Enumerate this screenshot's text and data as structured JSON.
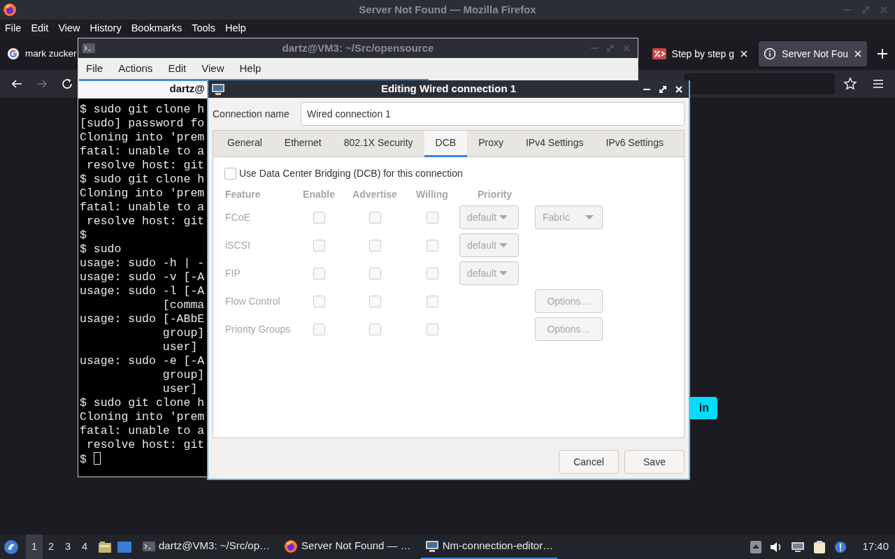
{
  "firefox": {
    "title": "Server Not Found — Mozilla Firefox",
    "menu": [
      "File",
      "Edit",
      "View",
      "History",
      "Bookmarks",
      "Tools",
      "Help"
    ],
    "tabs": [
      {
        "label": "mark zucker",
        "kind": "google",
        "selected": false
      },
      {
        "label": "Step by step g",
        "kind": "percent",
        "selected": false
      },
      {
        "label": "Server Not Fou",
        "kind": "info",
        "selected": true
      }
    ],
    "page_button": "in"
  },
  "terminal": {
    "title": "dartz@VM3: ~/Src/opensource",
    "menu": [
      "File",
      "Actions",
      "Edit",
      "View",
      "Help"
    ],
    "tab": "dartz@",
    "lines": [
      "$ sudo git clone h",
      "[sudo] password fo",
      "Cloning into 'prem",
      "fatal: unable to a",
      " resolve host: git",
      "$ sudo git clone h",
      "Cloning into 'prem",
      "fatal: unable to a",
      " resolve host: git",
      "$",
      "$ sudo",
      "usage: sudo -h | -",
      "usage: sudo -v [-A",
      "usage: sudo -l [-A",
      "            [comma",
      "usage: sudo [-ABbE",
      "            group]",
      "            user]",
      "usage: sudo -e [-A",
      "            group]",
      "            user]",
      "$ sudo git clone h",
      "Cloning into 'prem",
      "fatal: unable to a",
      " resolve host: git",
      "$ "
    ]
  },
  "dialog": {
    "title": "Editing Wired connection 1",
    "name_label": "Connection name",
    "name_value": "Wired connection 1",
    "tabs": [
      {
        "label": "General",
        "selected": false
      },
      {
        "label": "Ethernet",
        "selected": false
      },
      {
        "label": "802.1X Security",
        "selected": false
      },
      {
        "label": "DCB",
        "selected": true
      },
      {
        "label": "Proxy",
        "selected": false
      },
      {
        "label": "IPv4 Settings",
        "selected": false
      },
      {
        "label": "IPv6 Settings",
        "selected": false
      }
    ],
    "use_dcb": {
      "label": "Use Data Center Bridging (DCB) for this connection",
      "checked": false
    },
    "disabled": true,
    "columns": [
      "Feature",
      "Enable",
      "Advertise",
      "Willing",
      "Priority"
    ],
    "rows": [
      {
        "feature": "FCoE",
        "enable": false,
        "advertise": false,
        "willing": false,
        "priority": "default",
        "extra": {
          "kind": "select",
          "label": "Fabric"
        }
      },
      {
        "feature": "iSCSI",
        "enable": false,
        "advertise": false,
        "willing": false,
        "priority": "default"
      },
      {
        "feature": "FIP",
        "enable": false,
        "advertise": false,
        "willing": false,
        "priority": "default"
      },
      {
        "feature": "Flow Control",
        "enable": false,
        "advertise": false,
        "willing": false,
        "extra": {
          "kind": "button",
          "label": "Options…"
        }
      },
      {
        "feature": "Priority Groups",
        "enable": false,
        "advertise": false,
        "willing": false,
        "extra": {
          "kind": "button",
          "label": "Options…"
        }
      }
    ],
    "buttons": [
      "Cancel",
      "Save"
    ]
  },
  "taskbar": {
    "workspaces": [
      {
        "label": "1",
        "selected": true
      },
      {
        "label": "2",
        "selected": false
      },
      {
        "label": "3",
        "selected": false
      },
      {
        "label": "4",
        "selected": false
      }
    ],
    "tasks": [
      {
        "label": "dartz@VM3: ~/Src/op…",
        "kind": "terminal",
        "selected": false
      },
      {
        "label": "Server Not Found — …",
        "kind": "firefox",
        "selected": false
      },
      {
        "label": "Nm-connection-editor…",
        "kind": "network",
        "selected": true
      }
    ],
    "clock": "17:40"
  }
}
